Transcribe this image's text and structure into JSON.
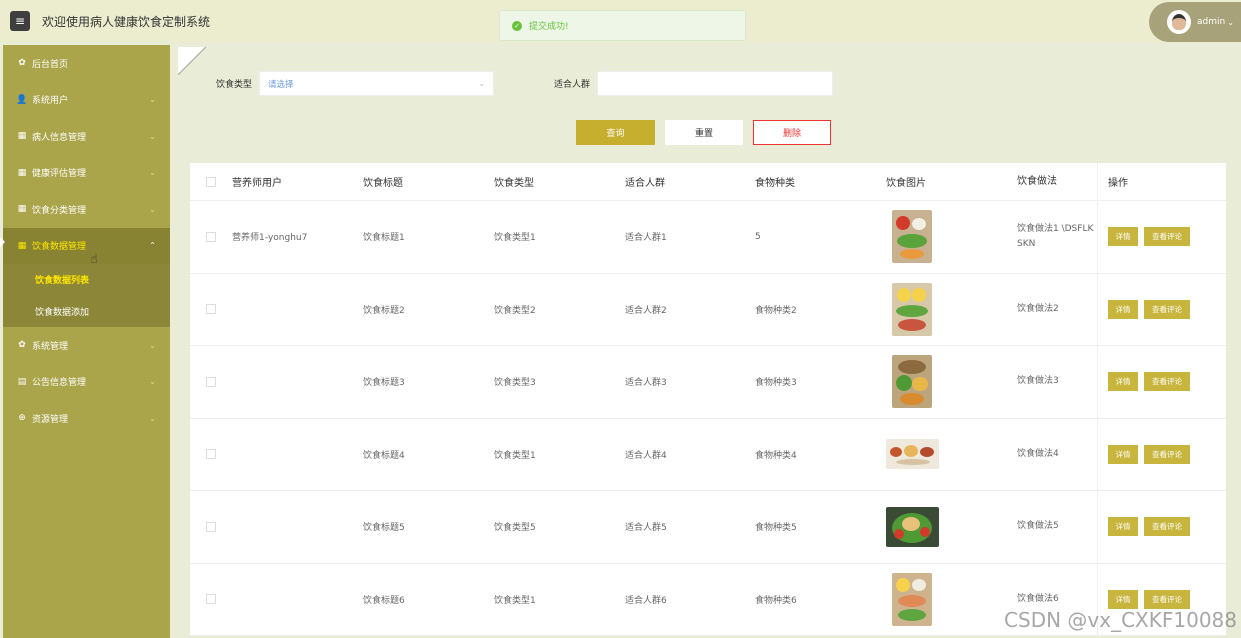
{
  "header": {
    "menu_icon": "menu-icon",
    "title": "欢迎使用病人健康饮食定制系统",
    "username": "admin"
  },
  "toast": {
    "message": "提交成功!",
    "icon": "success-check-icon",
    "color": "#67c23a"
  },
  "sidebar": {
    "items": [
      {
        "label": "后台首页",
        "icon": "home-icon",
        "has_arrow": false
      },
      {
        "label": "系统用户",
        "icon": "user-icon",
        "has_arrow": true
      },
      {
        "label": "病人信息管理",
        "icon": "grid-icon",
        "has_arrow": true
      },
      {
        "label": "健康评估管理",
        "icon": "grid-icon",
        "has_arrow": true
      },
      {
        "label": "饮食分类管理",
        "icon": "grid-icon",
        "has_arrow": true
      },
      {
        "label": "饮食数据管理",
        "icon": "grid-icon",
        "has_arrow": true,
        "expanded": true
      },
      {
        "label": "系统管理",
        "icon": "gear-icon",
        "has_arrow": true
      },
      {
        "label": "公告信息管理",
        "icon": "document-icon",
        "has_arrow": true
      },
      {
        "label": "资源管理",
        "icon": "plus-circle-icon",
        "has_arrow": true
      }
    ],
    "sub_items": [
      {
        "label": "饮食数据列表",
        "current": true
      },
      {
        "label": "饮食数据添加",
        "current": false
      }
    ],
    "colors": {
      "background": "#aaa44a",
      "active": "#888332",
      "highlight": "#ffe600"
    }
  },
  "search": {
    "diet_type_label": "饮食类型",
    "diet_type_placeholder": "请选择",
    "crowd_label": "适合人群",
    "crowd_value": ""
  },
  "buttons": {
    "query": "查询",
    "reset": "重置",
    "delete": "删除"
  },
  "table": {
    "columns": [
      "营养师用户",
      "饮食标题",
      "饮食类型",
      "适合人群",
      "食物种类",
      "饮食图片",
      "饮食做法",
      "操作"
    ],
    "ops": {
      "detail": "详情",
      "review": "查看评论"
    },
    "rows": [
      {
        "user": "营养师1-yonghu7",
        "title": "饮食标题1",
        "type": "饮食类型1",
        "crowd": "适合人群1",
        "kind": "5",
        "method": "饮食做法1 \\DSFLKSKN",
        "image": "meal-box-icon"
      },
      {
        "user": "",
        "title": "饮食标题2",
        "type": "饮食类型2",
        "crowd": "适合人群2",
        "kind": "食物种类2",
        "method": "饮食做法2",
        "image": "meal-box-icon"
      },
      {
        "user": "",
        "title": "饮食标题3",
        "type": "饮食类型3",
        "crowd": "适合人群3",
        "kind": "食物种类3",
        "method": "饮食做法3",
        "image": "meal-box-icon"
      },
      {
        "user": "",
        "title": "饮食标题4",
        "type": "饮食类型1",
        "crowd": "适合人群4",
        "kind": "食物种类4",
        "method": "饮食做法4",
        "image": "meal-tray-icon"
      },
      {
        "user": "",
        "title": "饮食标题5",
        "type": "饮食类型5",
        "crowd": "适合人群5",
        "kind": "食物种类5",
        "method": "饮食做法5",
        "image": "salad-bowl-icon"
      },
      {
        "user": "",
        "title": "饮食标题6",
        "type": "饮食类型1",
        "crowd": "适合人群6",
        "kind": "食物种类6",
        "method": "饮食做法6",
        "image": "meal-box-icon"
      }
    ]
  },
  "watermark": "CSDN @vx_CXKF10088"
}
